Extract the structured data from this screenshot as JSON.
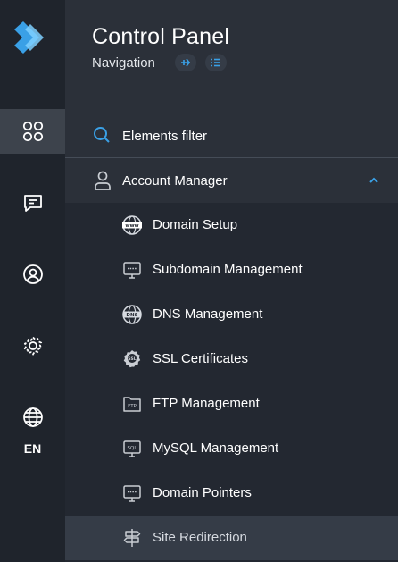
{
  "app": {
    "title": "Control Panel",
    "subtitle": "Navigation",
    "accent": "#3aa0e6"
  },
  "rail": {
    "items": [
      {
        "icon": "apps-grid-icon",
        "active": true
      },
      {
        "icon": "chat-icon",
        "active": false
      },
      {
        "icon": "user-circle-icon",
        "active": false
      },
      {
        "icon": "settings-gear-icon",
        "active": false
      },
      {
        "icon": "globe-icon",
        "active": false
      }
    ],
    "language": "EN"
  },
  "nav": {
    "filter_label": "Elements filter",
    "group": {
      "label": "Account Manager",
      "icon": "user-icon",
      "expanded": true
    },
    "items": [
      {
        "label": "Domain Setup",
        "icon": "www-globe-icon"
      },
      {
        "label": "Subdomain Management",
        "icon": "monitor-icon"
      },
      {
        "label": "DNS Management",
        "icon": "dns-globe-icon"
      },
      {
        "label": "SSL Certificates",
        "icon": "ssl-badge-icon"
      },
      {
        "label": "FTP Management",
        "icon": "ftp-folder-icon"
      },
      {
        "label": "MySQL Management",
        "icon": "sql-monitor-icon"
      },
      {
        "label": "Domain Pointers",
        "icon": "monitor-icon"
      },
      {
        "label": "Site Redirection",
        "icon": "signpost-icon",
        "active": true
      }
    ]
  }
}
